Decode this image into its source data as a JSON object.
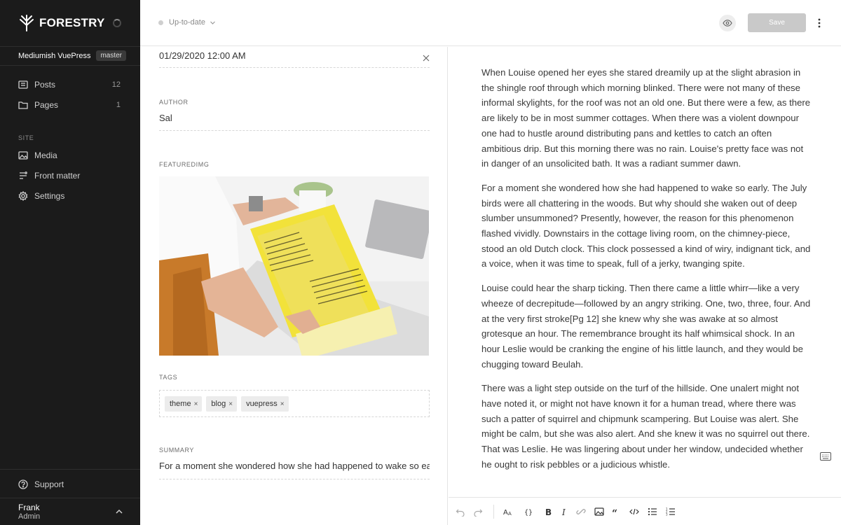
{
  "sidebar": {
    "brand": "FORESTRY",
    "site_name": "Mediumish VuePress",
    "branch": "master",
    "nav": [
      {
        "label": "Posts",
        "count": "12",
        "icon": "posts-icon"
      },
      {
        "label": "Pages",
        "count": "1",
        "icon": "folder-icon"
      }
    ],
    "section_label": "SITE",
    "site_nav": [
      {
        "label": "Media",
        "icon": "image-icon"
      },
      {
        "label": "Front matter",
        "icon": "front-matter-icon"
      },
      {
        "label": "Settings",
        "icon": "gear-icon"
      }
    ],
    "support_label": "Support",
    "user": {
      "name": "Frank",
      "role": "Admin"
    }
  },
  "topbar": {
    "status": "Up-to-date",
    "save_label": "Save"
  },
  "front_matter": {
    "date_value": "01/29/2020 12:00 AM",
    "author_label": "AUTHOR",
    "author_value": "Sal",
    "featured_label": "FEATUREDIMG",
    "tags_label": "TAGS",
    "tags": [
      "theme",
      "blog",
      "vuepress"
    ],
    "summary_label": "SUMMARY",
    "summary_value": "For a moment she wondered how she had happened to wake so early. The"
  },
  "editor": {
    "paragraphs": [
      "When Louise opened her eyes she stared dreamily up at the slight abrasion in the shingle roof through which morning blinked. There were not many of these informal skylights, for the roof was not an old one. But there were a few, as there are likely to be in most summer cottages. When there was a violent downpour one had to hustle around distributing pans and kettles to catch an often ambitious drip. But this morning there was no rain. Louise's pretty face was not in danger of an unsolicited bath. It was a radiant summer dawn.",
      "For a moment she wondered how she had happened to wake so early. The July birds were all chattering in the woods. But why should she waken out of deep slumber unsummoned? Presently, however, the reason for this phenomenon flashed vividly. Downstairs in the cottage living room, on the chimney-piece, stood an old Dutch clock. This clock possessed a kind of wiry, indignant tick, and a voice, when it was time to speak, full of a jerky, twanging spite.",
      "Louise could hear the sharp ticking. Then there came a little whirr—like a very wheeze of decrepitude—followed by an angry striking. One, two, three, four. And at the very first stroke[Pg 12] she knew why she was awake at so almost grotesque an hour. The remembrance brought its half whimsical shock. In an hour Leslie would be cranking the engine of his little launch, and they would be chugging toward Beulah.",
      "There was a light step outside on the turf of the hillside. One unalert might not have noted it, or might not have known it for a human tread, where there was such a patter of squirrel and chipmunk scampering. But Louise was alert. She might be calm, but she was also alert. And she knew it was no squirrel out there. That was Leslie. He was lingering about under her window, undecided whether he ought to risk pebbles or a judicious whistle."
    ]
  }
}
